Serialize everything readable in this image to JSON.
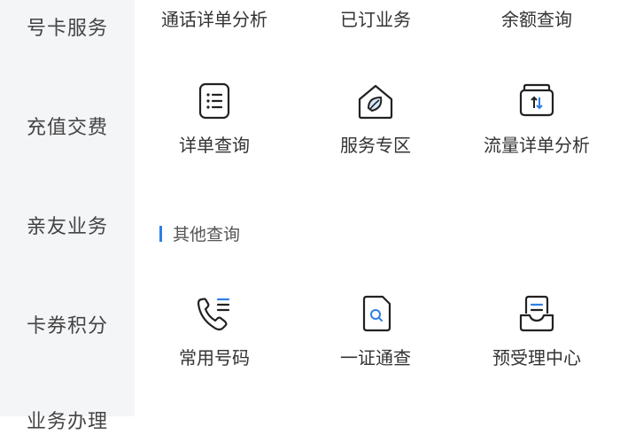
{
  "sidebar": {
    "items": [
      {
        "label": "号卡服务"
      },
      {
        "label": "充值交费"
      },
      {
        "label": "亲友业务"
      },
      {
        "label": "卡券积分"
      },
      {
        "label": "业务办理"
      }
    ]
  },
  "main": {
    "top_row": [
      {
        "label": "通话详单分析"
      },
      {
        "label": "已订业务"
      },
      {
        "label": "余额查询"
      }
    ],
    "row2": [
      {
        "label": "详单查询",
        "icon": "list-document-icon"
      },
      {
        "label": "服务专区",
        "icon": "home-leaf-icon"
      },
      {
        "label": "流量详单分析",
        "icon": "data-traffic-icon"
      }
    ],
    "section": {
      "title": "其他查询"
    },
    "row3": [
      {
        "label": "常用号码",
        "icon": "phone-list-icon"
      },
      {
        "label": "一证通查",
        "icon": "id-search-icon"
      },
      {
        "label": "预受理中心",
        "icon": "inbox-document-icon"
      }
    ]
  },
  "colors": {
    "accent": "#2f7fe6",
    "sidebar_bg": "#f4f5f7",
    "icon_stroke": "#222222"
  }
}
